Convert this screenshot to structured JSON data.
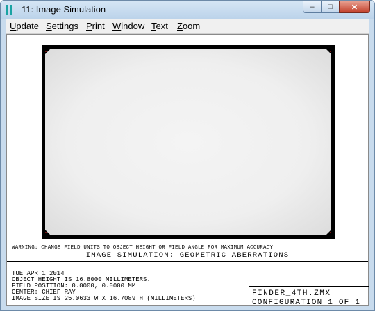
{
  "window": {
    "title": "11: Image Simulation",
    "minimize_glyph": "–",
    "maximize_glyph": "□",
    "close_glyph": "✕",
    "app_icon": "zemax-window-icon",
    "accent_color": "#1aa3a3"
  },
  "menu": [
    "Update",
    "Settings",
    "Print",
    "Window",
    "Text",
    "Zoom"
  ],
  "plot": {
    "warning": "WARNING: CHANGE FIELD UNITS TO OBJECT HEIGHT OR FIELD ANGLE FOR MAXIMUM ACCURACY",
    "caption": "IMAGE SIMULATION: GEOMETRIC ABERRATIONS",
    "info_lines": [
      "TUE APR 1 2014",
      "OBJECT HEIGHT IS 16.8000 MILLIMETERS.",
      "FIELD POSITION: 0.0000, 0.0000 MM",
      "CENTER: CHIEF RAY",
      "IMAGE SIZE IS 25.0633 W X 16.7089 H (MILLIMETERS)"
    ],
    "file_name": "FINDER_4TH.ZMX",
    "configuration": "CONFIGURATION 1 OF 1"
  }
}
